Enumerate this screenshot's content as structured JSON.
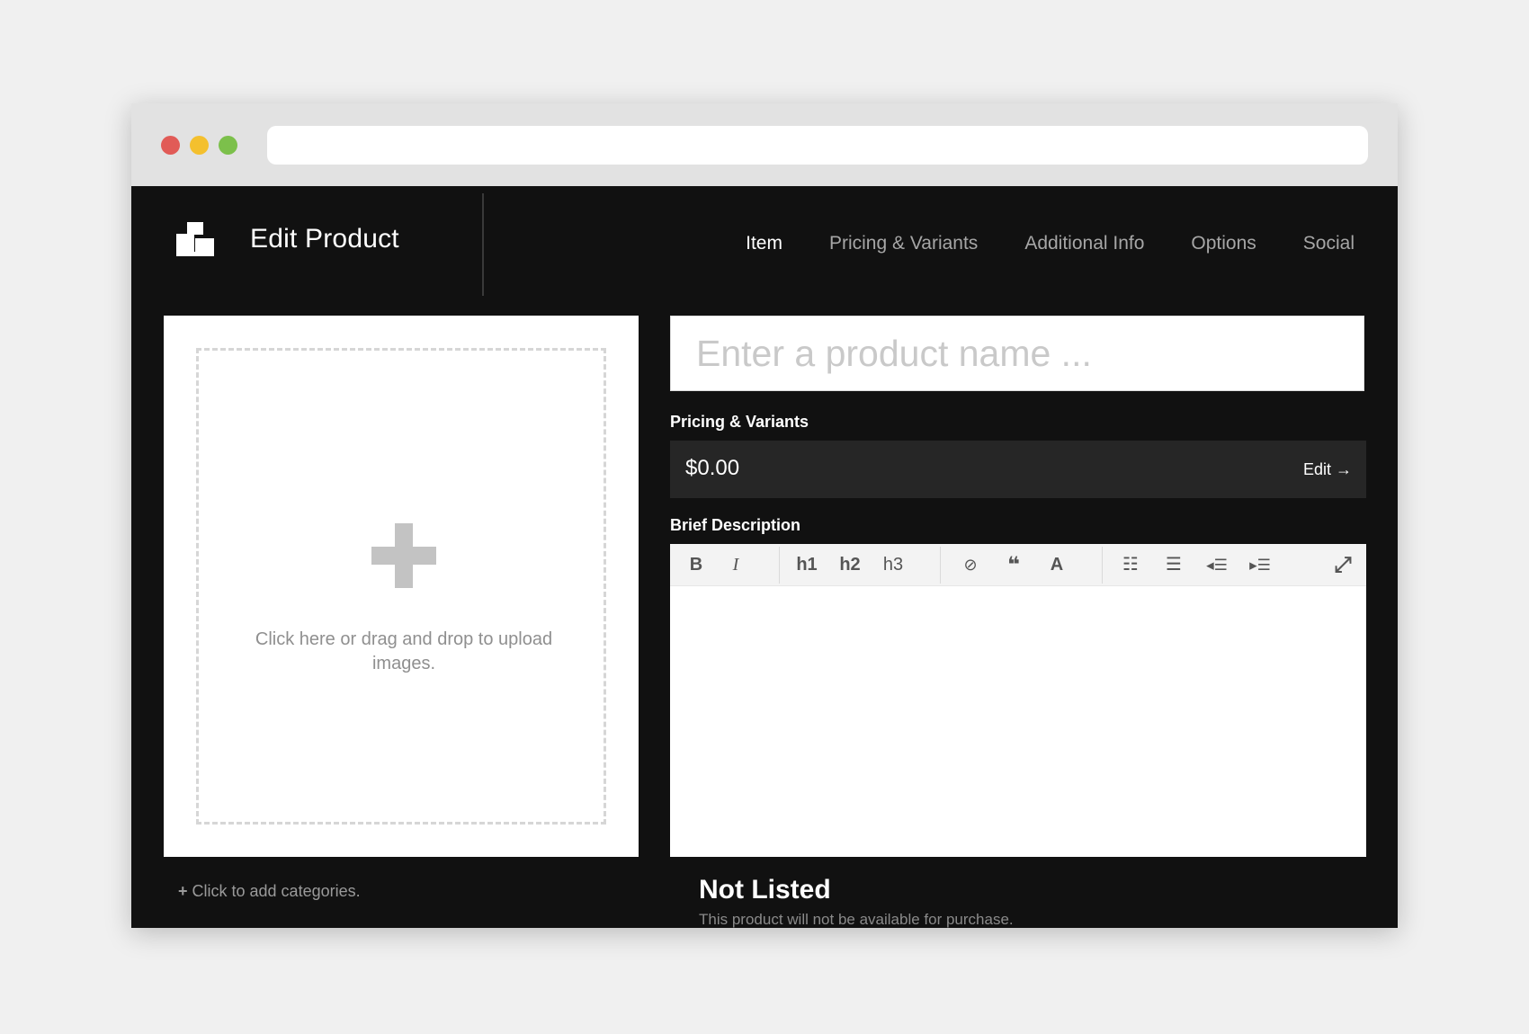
{
  "window": {
    "controls": [
      "close",
      "minimize",
      "maximize"
    ],
    "colors": {
      "close": "#e15b57",
      "minimize": "#f4c02e",
      "maximize": "#7cc04b"
    }
  },
  "header": {
    "app_icon": "blocks-logo-icon",
    "title": "Edit Product",
    "tabs": [
      {
        "label": "Item",
        "active": true
      },
      {
        "label": "Pricing & Variants",
        "active": false
      },
      {
        "label": "Additional Info",
        "active": false
      },
      {
        "label": "Options",
        "active": false
      },
      {
        "label": "Social",
        "active": false
      }
    ]
  },
  "image_upload": {
    "icon": "plus-icon",
    "text": "Click here or drag and drop to upload images."
  },
  "categories": {
    "icon": "plus-icon",
    "label": "Click to add categories."
  },
  "product": {
    "name_value": "",
    "name_placeholder": "Enter a product name ..."
  },
  "pricing": {
    "label": "Pricing & Variants",
    "price": "$0.00",
    "edit_label": "Edit →"
  },
  "description": {
    "label": "Brief Description",
    "toolbar": [
      {
        "name": "bold",
        "glyph": "B"
      },
      {
        "name": "italic",
        "glyph": "I"
      },
      {
        "name": "heading-1",
        "glyph": "h1"
      },
      {
        "name": "heading-2",
        "glyph": "h2"
      },
      {
        "name": "heading-3",
        "glyph": "h3"
      },
      {
        "name": "unlink-icon",
        "glyph": "⊘"
      },
      {
        "name": "quote-icon",
        "glyph": "❝"
      },
      {
        "name": "clear-format-icon",
        "glyph": "A"
      },
      {
        "name": "bullet-list-icon",
        "glyph": "☷"
      },
      {
        "name": "numbered-list-icon",
        "glyph": "☰"
      },
      {
        "name": "outdent-icon",
        "glyph": "◂☰"
      },
      {
        "name": "indent-icon",
        "glyph": "▸☰"
      },
      {
        "name": "fullscreen-icon",
        "glyph": "⤢"
      }
    ]
  },
  "status": {
    "title": "Not Listed",
    "subtitle": "This product will not be available for purchase."
  }
}
